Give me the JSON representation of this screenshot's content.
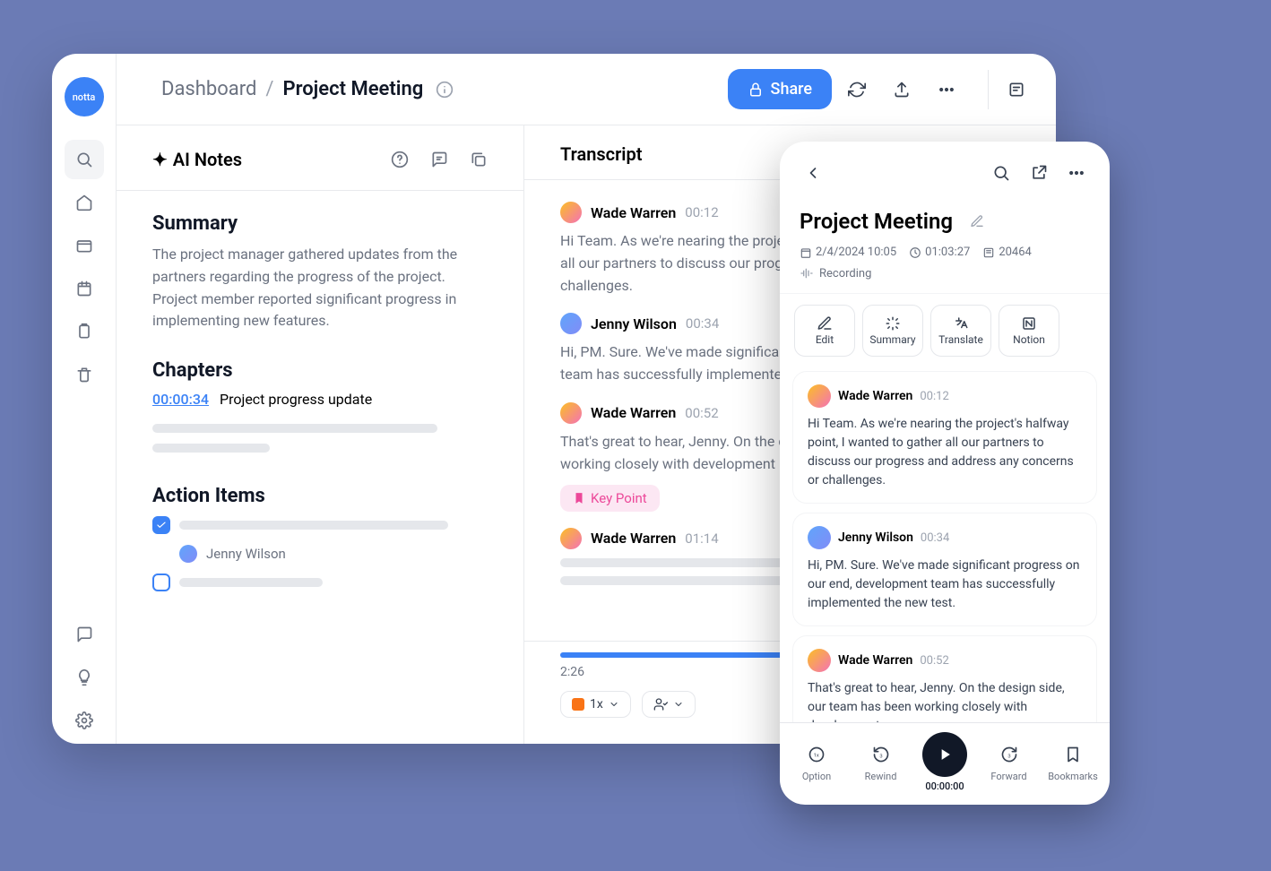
{
  "logo": "notta",
  "breadcrumb": {
    "dashboard": "Dashboard",
    "separator": "/",
    "title": "Project Meeting"
  },
  "share_label": "Share",
  "ai_notes": {
    "header": "AI Notes",
    "summary_heading": "Summary",
    "summary_text": "The project manager gathered updates from the partners regarding the progress of the project. Project member reported significant progress in implementing new features.",
    "chapters_heading": "Chapters",
    "chapter_time": "00:00:34",
    "chapter_title": "Project progress update",
    "action_heading": "Action Items",
    "action_assignee": "Jenny Wilson"
  },
  "transcript": {
    "header": "Transcript",
    "items": [
      {
        "speaker": "Wade Warren",
        "time": "00:12",
        "text": "Hi Team. As we're nearing the project's halfway point, I wanted to gather all our partners to discuss our progress and address any concerns or challenges."
      },
      {
        "speaker": "Jenny Wilson",
        "time": "00:34",
        "text": "Hi, PM. Sure. We've made significant progress on our end, development team has successfully implemented the new test."
      },
      {
        "speaker": "Wade Warren",
        "time": "00:52",
        "text": "That's great to hear, Jenny. On the design side, our team has been working closely with development"
      },
      {
        "speaker": "Wade Warren",
        "time": "01:14",
        "text": ""
      }
    ],
    "key_point_label": "Key Point",
    "current_time": "2:26",
    "speed": "1x"
  },
  "mobile": {
    "title": "Project Meeting",
    "date": "2/4/2024 10:05",
    "duration": "01:03:27",
    "words": "20464",
    "recording": "Recording",
    "tools": {
      "edit": "Edit",
      "summary": "Summary",
      "translate": "Translate",
      "notion": "Notion"
    },
    "msgs": [
      {
        "speaker": "Wade Warren",
        "time": "00:12",
        "text": "Hi Team. As we're nearing the project's halfway point, I wanted to gather all our partners to discuss our progress and address any concerns or challenges."
      },
      {
        "speaker": "Jenny Wilson",
        "time": "00:34",
        "text": "Hi, PM. Sure. We've made significant progress on our end, development team has successfully implemented the new test."
      },
      {
        "speaker": "Wade Warren",
        "time": "00:52",
        "text": "That's great to hear, Jenny. On the design side, our team has been working closely with development"
      }
    ],
    "controls": {
      "option": "Option",
      "rewind": "Rewind",
      "time": "00:00:00",
      "forward": "Forward",
      "bookmarks": "Bookmarks"
    }
  }
}
